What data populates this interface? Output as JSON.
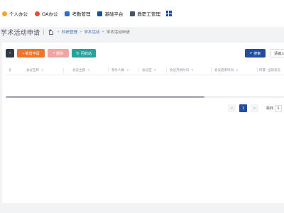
{
  "nav": {
    "items": [
      {
        "label": "个人办公",
        "icon": "user-office-icon",
        "color": "#f5a623"
      },
      {
        "label": "OA办公",
        "icon": "oa-icon",
        "color": "#e84c3d"
      },
      {
        "label": "考勤管理",
        "icon": "attendance-icon",
        "color": "#2d6bd1"
      },
      {
        "label": "基础平台",
        "icon": "platform-icon",
        "color": "#1f4e9e"
      },
      {
        "label": "教职工管理",
        "icon": "staff-icon",
        "color": "#475569"
      }
    ],
    "apps_icon": "grid-apps-icon"
  },
  "page": {
    "title": "学术活动申请",
    "breadcrumb": [
      "科研管理",
      "学术活动",
      "学术活动申请"
    ]
  },
  "toolbar": {
    "refresh_icon": "refresh-icon",
    "add_label": "+ 新增申请",
    "delete_label": "删除",
    "recycle_label": "回收站",
    "search_label": "搜索",
    "input_placeholder": "请输入"
  },
  "table": {
    "columns": [
      "会议名称",
      "会议主题",
      "预计人数",
      "会议室",
      "会议开始时间",
      "会议结束时间",
      "所属",
      "当前状态"
    ]
  },
  "pagination": {
    "prev": "<",
    "current": "1",
    "next": ">",
    "goto_label": "跳转",
    "goto_value": "1"
  },
  "colors": {
    "primary": "#1f4e9e",
    "add": "#f0742b",
    "delete": "#f2a3a3",
    "recycle": "#24a39a",
    "refresh": "#2f3a45"
  }
}
